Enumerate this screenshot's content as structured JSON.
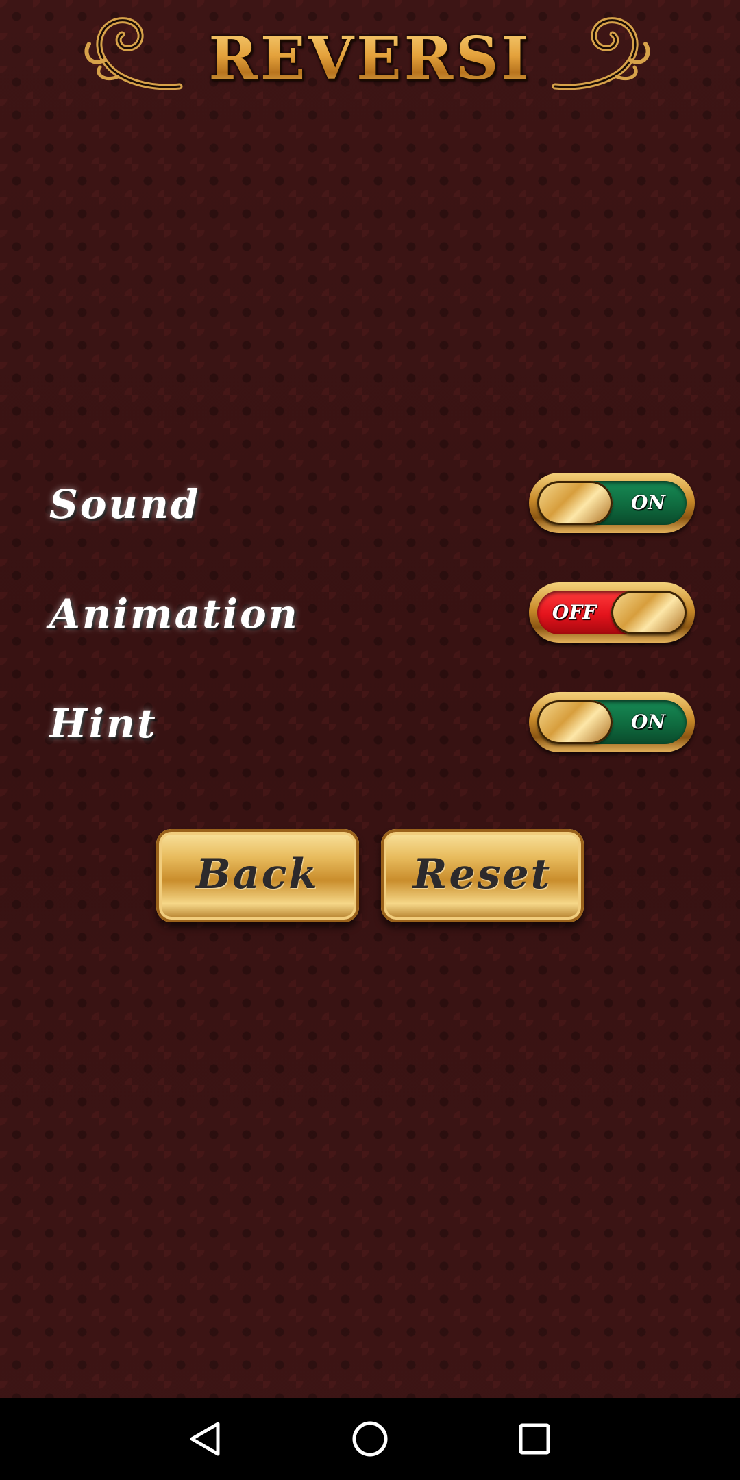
{
  "app": {
    "title": "REVERSI"
  },
  "settings": [
    {
      "label": "Sound",
      "state": "on",
      "state_label": "ON"
    },
    {
      "label": "Animation",
      "state": "off",
      "state_label": "OFF"
    },
    {
      "label": "Hint",
      "state": "on",
      "state_label": "ON"
    }
  ],
  "buttons": {
    "back_label": "Back",
    "reset_label": "Reset"
  },
  "colors": {
    "background": "#3a1414",
    "gold": "#e4a23c",
    "toggle_on": "#0f6b3f",
    "toggle_off": "#e3131c"
  },
  "navbar": {
    "icons": [
      "back-triangle-icon",
      "home-circle-icon",
      "recents-square-icon"
    ]
  }
}
